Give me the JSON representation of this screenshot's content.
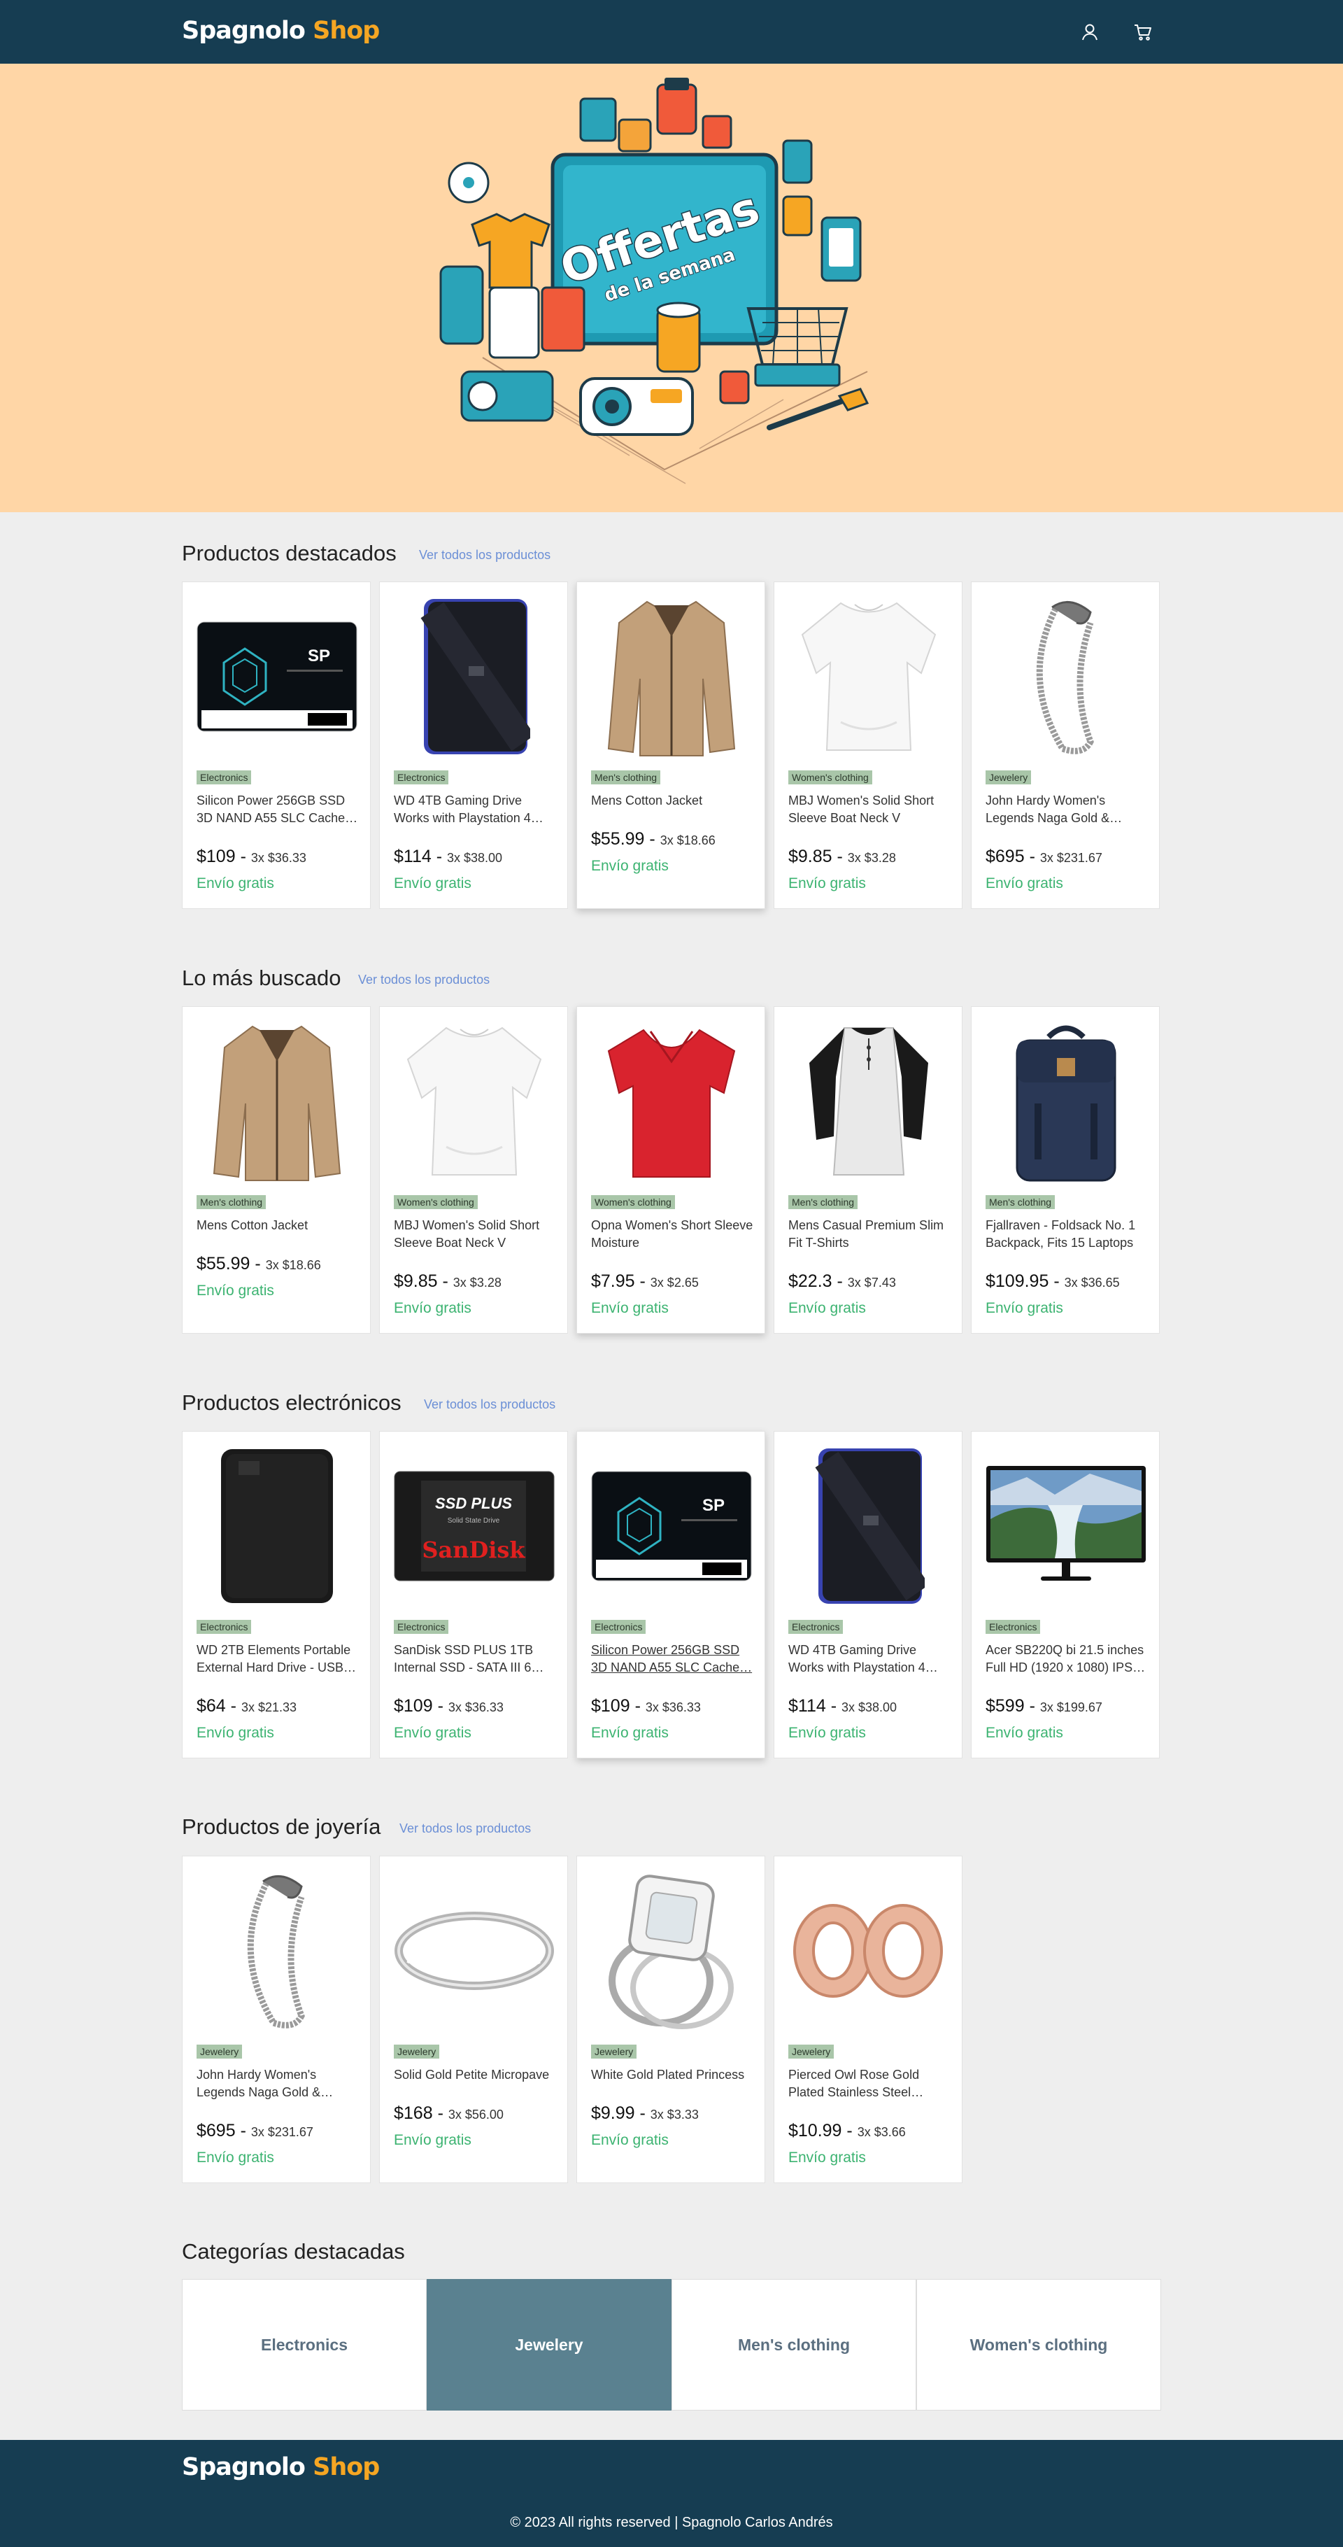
{
  "brand": {
    "name_part1": "Spagnolo",
    "name_part2": "Shop"
  },
  "header": {
    "user_icon": "user-icon",
    "cart_icon": "cart-icon"
  },
  "hero": {
    "text_line1": "Offertas",
    "text_line2": "de la semana"
  },
  "sections": [
    {
      "title": "Productos destacados",
      "link": "Ver todos los productos",
      "products": [
        {
          "category": "Electronics",
          "name": "Silicon Power 256GB SSD 3D NAND A55 SLC Cache…",
          "price": "$109",
          "installments": "3x $36.33",
          "shipping": "Envío gratis"
        },
        {
          "category": "Electronics",
          "name": "WD 4TB Gaming Drive Works with Playstation 4…",
          "price": "$114",
          "installments": "3x $38.00",
          "shipping": "Envío gratis"
        },
        {
          "category": "Men's clothing",
          "name": "Mens Cotton Jacket",
          "price": "$55.99",
          "installments": "3x $18.66",
          "shipping": "Envío gratis"
        },
        {
          "category": "Women's clothing",
          "name": "MBJ Women's Solid Short Sleeve Boat Neck V",
          "price": "$9.85",
          "installments": "3x $3.28",
          "shipping": "Envío gratis"
        },
        {
          "category": "Jewelery",
          "name": "John Hardy Women's Legends Naga Gold &…",
          "price": "$695",
          "installments": "3x $231.67",
          "shipping": "Envío gratis"
        }
      ]
    },
    {
      "title": "Lo más buscado",
      "link": "Ver todos los productos",
      "products": [
        {
          "category": "Men's clothing",
          "name": "Mens Cotton Jacket",
          "price": "$55.99",
          "installments": "3x $18.66",
          "shipping": "Envío gratis"
        },
        {
          "category": "Women's clothing",
          "name": "MBJ Women's Solid Short Sleeve Boat Neck V",
          "price": "$9.85",
          "installments": "3x $3.28",
          "shipping": "Envío gratis"
        },
        {
          "category": "Women's clothing",
          "name": "Opna Women's Short Sleeve Moisture",
          "price": "$7.95",
          "installments": "3x $2.65",
          "shipping": "Envío gratis"
        },
        {
          "category": "Men's clothing",
          "name": "Mens Casual Premium Slim Fit T-Shirts",
          "price": "$22.3",
          "installments": "3x $7.43",
          "shipping": "Envío gratis"
        },
        {
          "category": "Men's clothing",
          "name": "Fjallraven - Foldsack No. 1 Backpack, Fits 15 Laptops",
          "price": "$109.95",
          "installments": "3x $36.65",
          "shipping": "Envío gratis"
        }
      ]
    },
    {
      "title": "Productos electrónicos",
      "link": "Ver todos los productos",
      "products": [
        {
          "category": "Electronics",
          "name": "WD 2TB Elements Portable External Hard Drive - USB…",
          "price": "$64",
          "installments": "3x $21.33",
          "shipping": "Envío gratis"
        },
        {
          "category": "Electronics",
          "name": "SanDisk SSD PLUS 1TB Internal SSD - SATA III 6…",
          "price": "$109",
          "installments": "3x $36.33",
          "shipping": "Envío gratis"
        },
        {
          "category": "Electronics",
          "name": "Silicon Power 256GB SSD 3D NAND A55 SLC Cache…",
          "price": "$109",
          "installments": "3x $36.33",
          "shipping": "Envío gratis"
        },
        {
          "category": "Electronics",
          "name": "WD 4TB Gaming Drive Works with Playstation 4…",
          "price": "$114",
          "installments": "3x $38.00",
          "shipping": "Envío gratis"
        },
        {
          "category": "Electronics",
          "name": "Acer SB220Q bi 21.5 inches Full HD (1920 x 1080) IPS…",
          "price": "$599",
          "installments": "3x $199.67",
          "shipping": "Envío gratis"
        }
      ]
    },
    {
      "title": "Productos de joyería",
      "link": "Ver todos los productos",
      "products": [
        {
          "category": "Jewelery",
          "name": "John Hardy Women's Legends Naga Gold &…",
          "price": "$695",
          "installments": "3x $231.67",
          "shipping": "Envío gratis"
        },
        {
          "category": "Jewelery",
          "name": "Solid Gold Petite Micropave",
          "price": "$168",
          "installments": "3x $56.00",
          "shipping": "Envío gratis"
        },
        {
          "category": "Jewelery",
          "name": "White Gold Plated Princess",
          "price": "$9.99",
          "installments": "3x $3.33",
          "shipping": "Envío gratis"
        },
        {
          "category": "Jewelery",
          "name": "Pierced Owl Rose Gold Plated Stainless Steel…",
          "price": "$10.99",
          "installments": "3x $3.66",
          "shipping": "Envío gratis"
        }
      ]
    }
  ],
  "categories": {
    "title": "Categorías destacadas",
    "items": [
      "Electronics",
      "Jewelery",
      "Men's clothing",
      "Women's clothing"
    ],
    "active": "Jewelery"
  },
  "footer": {
    "copyright": "© 2023 All rights reserved | Spagnolo Carlos Andrés"
  },
  "colors": {
    "header_bg": "#163d52",
    "brand_accent": "#f5a623",
    "hero_bg": "#ffd6a6",
    "shipping_green": "#3cb371",
    "badge_bg": "#a9c6a9",
    "link_blue": "#6b8fd6",
    "active_category": "#5a8190"
  }
}
